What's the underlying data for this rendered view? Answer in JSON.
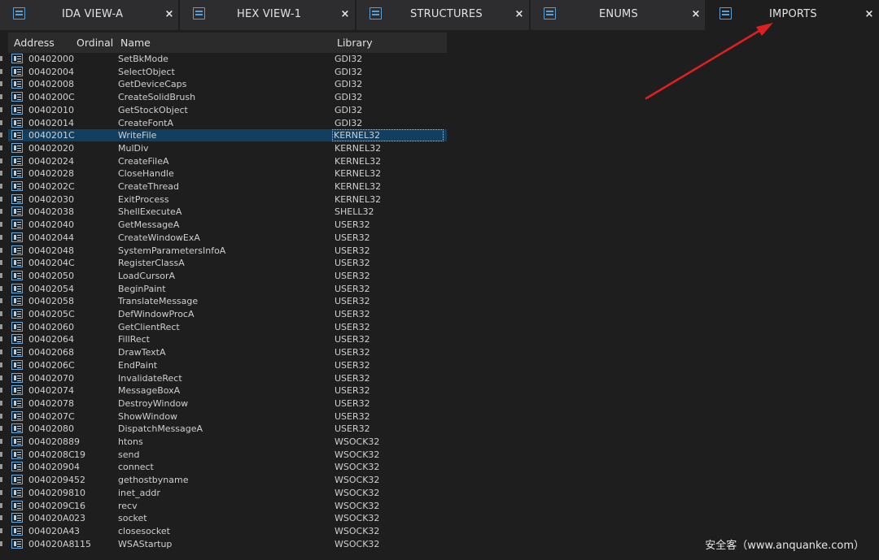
{
  "tabs": [
    {
      "title": "IDA VIEW-A",
      "icon": "ida-view-icon",
      "close": "×"
    },
    {
      "title": "HEX VIEW-1",
      "icon": "hex-view-icon",
      "close": "×"
    },
    {
      "title": "STRUCTURES",
      "icon": "structures-icon",
      "close": "×"
    },
    {
      "title": "ENUMS",
      "icon": "enums-icon",
      "close": "×"
    },
    {
      "title": "IMPORTS",
      "icon": "imports-icon",
      "close": "×"
    }
  ],
  "columns": {
    "address": "Address",
    "ordinal": "Ordinal",
    "name": "Name",
    "library": "Library"
  },
  "rows": [
    {
      "address": "00402000",
      "ordinal": "",
      "name": "SetBkMode",
      "library": "GDI32"
    },
    {
      "address": "00402004",
      "ordinal": "",
      "name": "SelectObject",
      "library": "GDI32"
    },
    {
      "address": "00402008",
      "ordinal": "",
      "name": "GetDeviceCaps",
      "library": "GDI32"
    },
    {
      "address": "0040200C",
      "ordinal": "",
      "name": "CreateSolidBrush",
      "library": "GDI32"
    },
    {
      "address": "00402010",
      "ordinal": "",
      "name": "GetStockObject",
      "library": "GDI32"
    },
    {
      "address": "00402014",
      "ordinal": "",
      "name": "CreateFontA",
      "library": "GDI32"
    },
    {
      "address": "0040201C",
      "ordinal": "",
      "name": "WriteFile",
      "library": "KERNEL32",
      "selected": true
    },
    {
      "address": "00402020",
      "ordinal": "",
      "name": "MulDiv",
      "library": "KERNEL32"
    },
    {
      "address": "00402024",
      "ordinal": "",
      "name": "CreateFileA",
      "library": "KERNEL32"
    },
    {
      "address": "00402028",
      "ordinal": "",
      "name": "CloseHandle",
      "library": "KERNEL32"
    },
    {
      "address": "0040202C",
      "ordinal": "",
      "name": "CreateThread",
      "library": "KERNEL32"
    },
    {
      "address": "00402030",
      "ordinal": "",
      "name": "ExitProcess",
      "library": "KERNEL32"
    },
    {
      "address": "00402038",
      "ordinal": "",
      "name": "ShellExecuteA",
      "library": "SHELL32"
    },
    {
      "address": "00402040",
      "ordinal": "",
      "name": "GetMessageA",
      "library": "USER32"
    },
    {
      "address": "00402044",
      "ordinal": "",
      "name": "CreateWindowExA",
      "library": "USER32"
    },
    {
      "address": "00402048",
      "ordinal": "",
      "name": "SystemParametersInfoA",
      "library": "USER32"
    },
    {
      "address": "0040204C",
      "ordinal": "",
      "name": "RegisterClassA",
      "library": "USER32"
    },
    {
      "address": "00402050",
      "ordinal": "",
      "name": "LoadCursorA",
      "library": "USER32"
    },
    {
      "address": "00402054",
      "ordinal": "",
      "name": "BeginPaint",
      "library": "USER32"
    },
    {
      "address": "00402058",
      "ordinal": "",
      "name": "TranslateMessage",
      "library": "USER32"
    },
    {
      "address": "0040205C",
      "ordinal": "",
      "name": "DefWindowProcA",
      "library": "USER32"
    },
    {
      "address": "00402060",
      "ordinal": "",
      "name": "GetClientRect",
      "library": "USER32"
    },
    {
      "address": "00402064",
      "ordinal": "",
      "name": "FillRect",
      "library": "USER32"
    },
    {
      "address": "00402068",
      "ordinal": "",
      "name": "DrawTextA",
      "library": "USER32"
    },
    {
      "address": "0040206C",
      "ordinal": "",
      "name": "EndPaint",
      "library": "USER32"
    },
    {
      "address": "00402070",
      "ordinal": "",
      "name": "InvalidateRect",
      "library": "USER32"
    },
    {
      "address": "00402074",
      "ordinal": "",
      "name": "MessageBoxA",
      "library": "USER32"
    },
    {
      "address": "00402078",
      "ordinal": "",
      "name": "DestroyWindow",
      "library": "USER32"
    },
    {
      "address": "0040207C",
      "ordinal": "",
      "name": "ShowWindow",
      "library": "USER32"
    },
    {
      "address": "00402080",
      "ordinal": "",
      "name": "DispatchMessageA",
      "library": "USER32"
    },
    {
      "address": "00402088",
      "ordinal": "9",
      "name": "htons",
      "library": "WSOCK32"
    },
    {
      "address": "0040208C",
      "ordinal": "19",
      "name": "send",
      "library": "WSOCK32"
    },
    {
      "address": "00402090",
      "ordinal": "4",
      "name": "connect",
      "library": "WSOCK32"
    },
    {
      "address": "00402094",
      "ordinal": "52",
      "name": "gethostbyname",
      "library": "WSOCK32"
    },
    {
      "address": "00402098",
      "ordinal": "10",
      "name": "inet_addr",
      "library": "WSOCK32"
    },
    {
      "address": "0040209C",
      "ordinal": "16",
      "name": "recv",
      "library": "WSOCK32"
    },
    {
      "address": "004020A0",
      "ordinal": "23",
      "name": "socket",
      "library": "WSOCK32"
    },
    {
      "address": "004020A4",
      "ordinal": "3",
      "name": "closesocket",
      "library": "WSOCK32"
    },
    {
      "address": "004020A8",
      "ordinal": "115",
      "name": "WSAStartup",
      "library": "WSOCK32"
    }
  ],
  "row_icon": "import-entry-icon",
  "watermark": "安全客（www.anquanke.com）",
  "colors": {
    "background": "#1e1e1e",
    "tabbar": "#2d2d30",
    "selection": "#123f60",
    "annotation_arrow": "#e02020"
  }
}
